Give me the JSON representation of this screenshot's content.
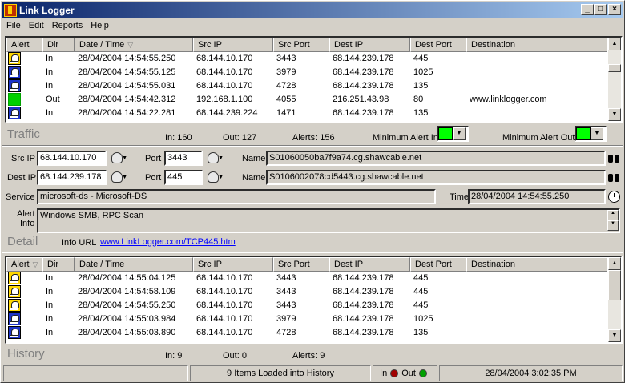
{
  "window": {
    "title": "Link Logger"
  },
  "menu": [
    "File",
    "Edit",
    "Reports",
    "Help"
  ],
  "columns": [
    "Alert",
    "Dir",
    "Date / Time",
    "Src IP",
    "Src Port",
    "Dest IP",
    "Dest Port",
    "Destination"
  ],
  "traffic": {
    "section_title": "Traffic",
    "rows": [
      {
        "alert": "yellow-skull",
        "dir": "In",
        "datetime": "28/04/2004 14:54:55.250",
        "src_ip": "68.144.10.170",
        "src_port": "3443",
        "dest_ip": "68.144.239.178",
        "dest_port": "445",
        "destination": ""
      },
      {
        "alert": "blue-skull",
        "dir": "In",
        "datetime": "28/04/2004 14:54:55.125",
        "src_ip": "68.144.10.170",
        "src_port": "3979",
        "dest_ip": "68.144.239.178",
        "dest_port": "1025",
        "destination": ""
      },
      {
        "alert": "blue-skull",
        "dir": "In",
        "datetime": "28/04/2004 14:54:55.031",
        "src_ip": "68.144.10.170",
        "src_port": "4728",
        "dest_ip": "68.144.239.178",
        "dest_port": "135",
        "destination": ""
      },
      {
        "alert": "green-square",
        "dir": "Out",
        "datetime": "28/04/2004 14:54:42.312",
        "src_ip": "192.168.1.100",
        "src_port": "4055",
        "dest_ip": "216.251.43.98",
        "dest_port": "80",
        "destination": "www.linklogger.com"
      },
      {
        "alert": "blue-skull",
        "dir": "In",
        "datetime": "28/04/2004 14:54:22.281",
        "src_ip": "68.144.239.224",
        "src_port": "1471",
        "dest_ip": "68.144.239.178",
        "dest_port": "135",
        "destination": ""
      }
    ],
    "in_count": "In: 160",
    "out_count": "Out: 127",
    "alerts_count": "Alerts: 156",
    "min_alert_in_label": "Minimum Alert In",
    "min_alert_out_label": "Minimum Alert Out",
    "min_alert_color": "#00ff00"
  },
  "detail": {
    "section_title": "Detail",
    "src_ip_label": "Src IP",
    "src_ip": "68.144.10.170",
    "src_port_label": "Port",
    "src_port": "3443",
    "src_name_label": "Name",
    "src_name": "S01060050ba7f9a74.cg.shawcable.net",
    "dest_ip_label": "Dest IP",
    "dest_ip": "68.144.239.178",
    "dest_port_label": "Port",
    "dest_port": "445",
    "dest_name_label": "Name",
    "dest_name": "S0106002078cd5443.cg.shawcable.net",
    "service_label": "Service",
    "service": "microsoft-ds - Microsoft-DS",
    "time_label": "Time",
    "time": "28/04/2004 14:54:55.250",
    "alert_info_label_1": "Alert",
    "alert_info_label_2": "Info",
    "alert_info": "Windows SMB, RPC Scan",
    "info_url_label": "Info URL",
    "info_url": "www.LinkLogger.com/TCP445.htm"
  },
  "history": {
    "section_title": "History",
    "rows": [
      {
        "alert": "yellow-skull",
        "dir": "In",
        "datetime": "28/04/2004 14:55:04.125",
        "src_ip": "68.144.10.170",
        "src_port": "3443",
        "dest_ip": "68.144.239.178",
        "dest_port": "445",
        "destination": ""
      },
      {
        "alert": "yellow-skull",
        "dir": "In",
        "datetime": "28/04/2004 14:54:58.109",
        "src_ip": "68.144.10.170",
        "src_port": "3443",
        "dest_ip": "68.144.239.178",
        "dest_port": "445",
        "destination": ""
      },
      {
        "alert": "yellow-skull",
        "dir": "In",
        "datetime": "28/04/2004 14:54:55.250",
        "src_ip": "68.144.10.170",
        "src_port": "3443",
        "dest_ip": "68.144.239.178",
        "dest_port": "445",
        "destination": ""
      },
      {
        "alert": "blue-skull",
        "dir": "In",
        "datetime": "28/04/2004 14:55:03.984",
        "src_ip": "68.144.10.170",
        "src_port": "3979",
        "dest_ip": "68.144.239.178",
        "dest_port": "1025",
        "destination": ""
      },
      {
        "alert": "blue-skull",
        "dir": "In",
        "datetime": "28/04/2004 14:55:03.890",
        "src_ip": "68.144.10.170",
        "src_port": "4728",
        "dest_ip": "68.144.239.178",
        "dest_port": "135",
        "destination": ""
      }
    ],
    "in_count": "In: 9",
    "out_count": "Out: 0",
    "alerts_count": "Alerts: 9"
  },
  "statusbar": {
    "message": "9 Items Loaded into History",
    "in_label": "In",
    "out_label": "Out",
    "in_led_color": "#a00000",
    "out_led_color": "#00a000",
    "datetime": "28/04/2004 3:02:35 PM"
  }
}
